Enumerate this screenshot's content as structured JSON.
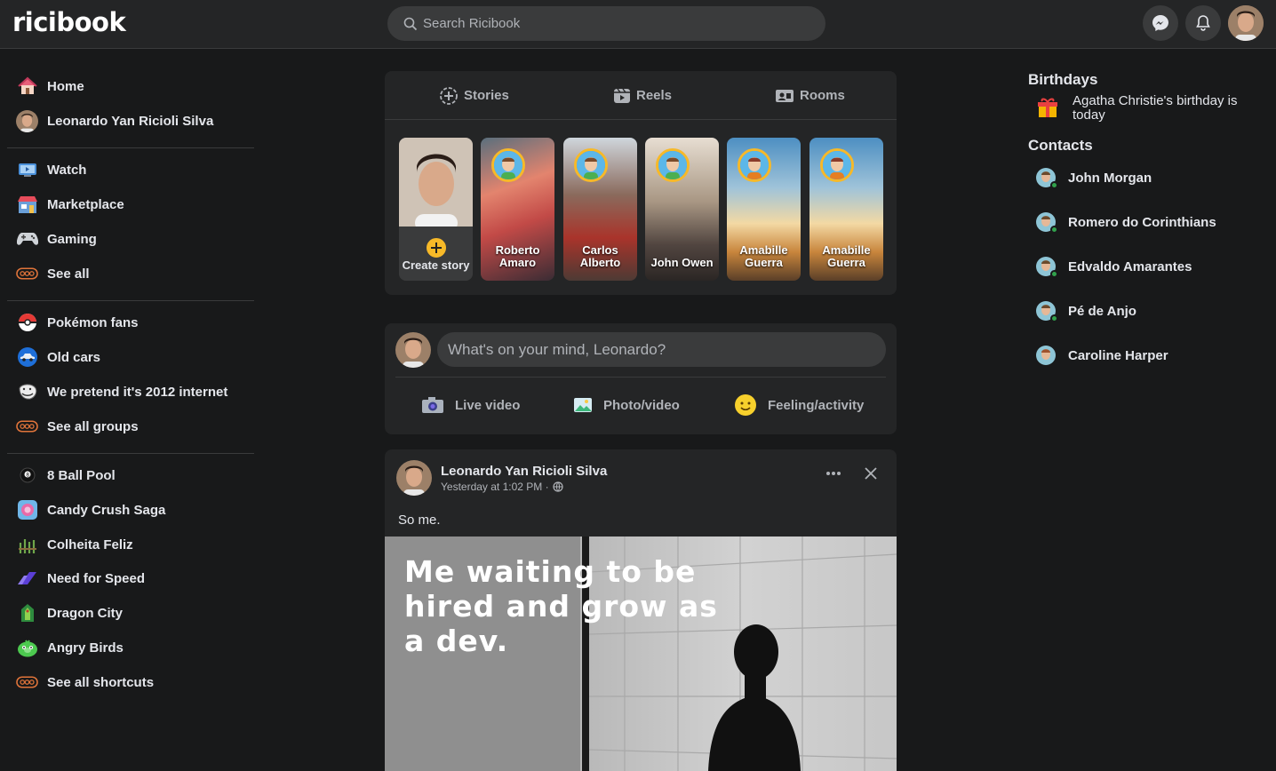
{
  "header": {
    "logo": "ricibook",
    "search_placeholder": "Search Ricibook",
    "icons": [
      "messenger-icon",
      "bell-icon",
      "profile-avatar"
    ]
  },
  "sidebar": {
    "top": [
      {
        "label": "Home",
        "icon": "home-icon"
      },
      {
        "label": "Leonardo Yan Ricioli Silva",
        "icon": "user-avatar"
      }
    ],
    "main": [
      {
        "label": "Watch",
        "icon": "watch-icon"
      },
      {
        "label": "Marketplace",
        "icon": "marketplace-icon"
      },
      {
        "label": "Gaming",
        "icon": "gaming-icon"
      },
      {
        "label": "See all",
        "icon": "see-all-icon"
      }
    ],
    "groups": [
      {
        "label": "Pokémon fans",
        "icon": "pokeball-icon"
      },
      {
        "label": "Old cars",
        "icon": "car-icon"
      },
      {
        "label": "We pretend it's 2012 internet",
        "icon": "troll-face-icon"
      },
      {
        "label": "See all groups",
        "icon": "see-all-icon"
      }
    ],
    "shortcuts": [
      {
        "label": "8 Ball Pool",
        "icon": "eight-ball-icon"
      },
      {
        "label": "Candy Crush Saga",
        "icon": "candy-icon"
      },
      {
        "label": "Colheita Feliz",
        "icon": "crop-icon"
      },
      {
        "label": "Need for Speed",
        "icon": "nfs-icon"
      },
      {
        "label": "Dragon City",
        "icon": "dragon-icon"
      },
      {
        "label": "Angry Birds",
        "icon": "angry-bird-icon"
      },
      {
        "label": "See all shortcuts",
        "icon": "see-all-icon"
      }
    ]
  },
  "stories_card": {
    "tabs": [
      "Stories",
      "Reels",
      "Rooms"
    ],
    "create_label": "Create story",
    "stories": [
      {
        "name": "Roberto Amaro"
      },
      {
        "name": "Carlos Alberto"
      },
      {
        "name": "John Owen"
      },
      {
        "name": "Amabille Guerra"
      },
      {
        "name": "Amabille Guerra"
      }
    ]
  },
  "composer": {
    "placeholder": "What's on your mind, Leonardo?",
    "actions": [
      "Live video",
      "Photo/video",
      "Feeling/activity"
    ]
  },
  "post": {
    "author": "Leonardo Yan Ricioli Silva",
    "time": "Yesterday at 1:02 PM ·",
    "text": "So me.",
    "image_text": "Me waiting to be hired and grow as a dev."
  },
  "right": {
    "birthdays_title": "Birthdays",
    "birthday_text": "Agatha Christie's birthday is today",
    "contacts_title": "Contacts",
    "contacts": [
      "John Morgan",
      "Romero do Corinthians",
      "Edvaldo Amarantes",
      "Pé de Anjo",
      "Caroline Harper"
    ]
  }
}
